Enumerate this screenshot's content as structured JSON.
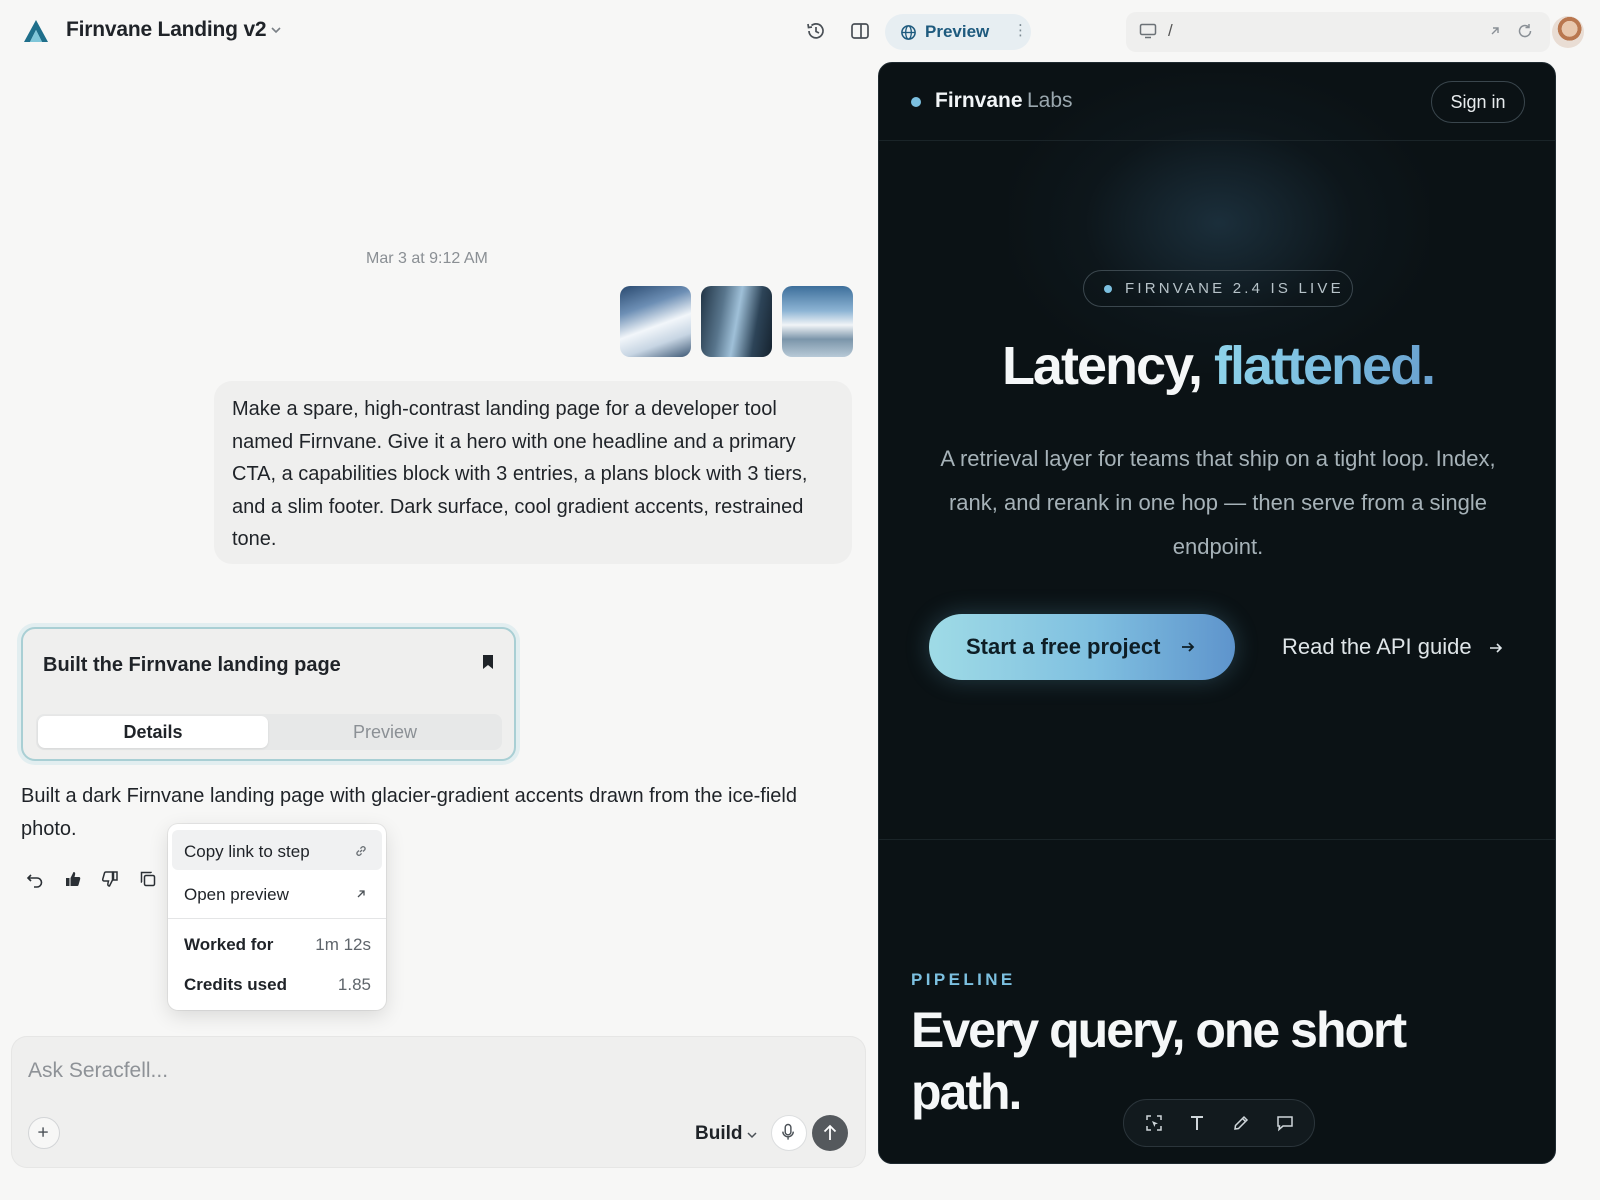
{
  "app": {
    "project_title": "Firnvane Landing v2",
    "preview_label": "Preview",
    "url_path": "/"
  },
  "chat": {
    "timestamp": "Mar 3 at 9:12 AM",
    "attachments": [
      "ice-field-photo-1",
      "glacier-photo-2",
      "mountain-photo-3"
    ],
    "user_message": "Make a spare, high-contrast landing page for a developer tool named Firnvane. Give it a hero with one headline and a primary CTA, a capabilities block with 3 entries, a plans block with 3 tiers, and a slim footer. Dark surface, cool gradient accents, restrained tone.",
    "task_card": {
      "title": "Built the Firnvane landing page",
      "tabs": [
        "Details",
        "Preview"
      ],
      "active_tab": "Details"
    },
    "assistant_message": "Built a dark Firnvane landing page with glacier-gradient accents drawn from the ice-field photo."
  },
  "context_menu": {
    "items": [
      "Copy link to step",
      "Open preview"
    ],
    "stats": [
      {
        "label": "Worked for",
        "value": "1m 12s"
      },
      {
        "label": "Credits used",
        "value": "1.85"
      }
    ]
  },
  "composer": {
    "placeholder": "Ask Seracfell...",
    "mode": "Build"
  },
  "site": {
    "brand": "Firnvane",
    "brand_suffix": "Labs",
    "sign_in": "Sign in",
    "badge": "FIRNVANE 2.4 IS LIVE",
    "headline_main": "Latency, ",
    "headline_accent": "flattened.",
    "lede": "A retrieval layer for teams that ship on a tight loop. Index, rank, and rerank in one hop — then serve from a single endpoint.",
    "cta_primary": "Start a free project",
    "cta_secondary": "Read the API guide",
    "section_eyebrow": "PIPELINE",
    "section_title": "Every query, one short path."
  },
  "colors": {
    "accent": "#7cc0e0",
    "preview_surface": "#0b1215",
    "cta_gradient_start": "#9fdbe6",
    "cta_gradient_end": "#5e94cc"
  }
}
